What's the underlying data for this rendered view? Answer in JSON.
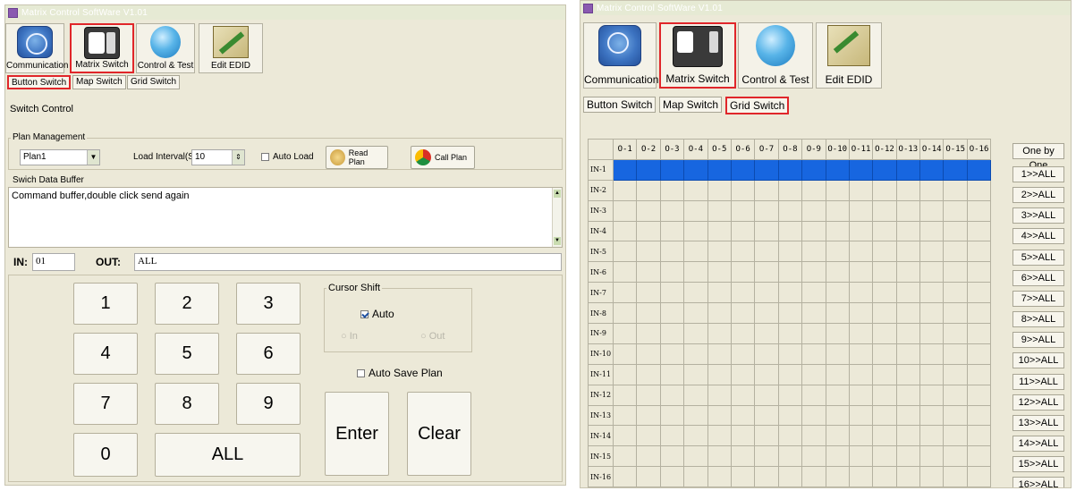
{
  "left_window": {
    "title": "Matrix Control SoftWare V1.01",
    "toolbar": [
      "Communication",
      "Matrix Switch",
      "Control & Test",
      "Edit EDID"
    ],
    "tabs": [
      "Button Switch",
      "Map Switch",
      "Grid Switch"
    ],
    "switch_control": "Switch Control",
    "plan_management": "Plan Management",
    "plan_value": "Plan1",
    "load_interval_label": "Load Interval(S)",
    "load_interval_value": "10",
    "auto_load": "Auto Load",
    "read_plan": "Read Plan",
    "call_plan": "Call Plan",
    "buffer_title": "Swich Data Buffer",
    "buffer_text": "Command buffer,double click send again",
    "in_label": "IN:",
    "in_value": "01",
    "out_label": "OUT:",
    "out_value": "ALL",
    "keys": [
      "1",
      "2",
      "3",
      "4",
      "5",
      "6",
      "7",
      "8",
      "9",
      "0",
      "ALL"
    ],
    "cursor_shift": "Cursor Shift",
    "auto": "Auto",
    "in_radio": "In",
    "out_radio": "Out",
    "auto_save_plan": "Auto Save Plan",
    "enter": "Enter",
    "clear": "Clear"
  },
  "right_window": {
    "title": "Matrix Control SoftWare V1.01",
    "toolbar": [
      "Communication",
      "Matrix Switch",
      "Control & Test",
      "Edit EDID"
    ],
    "tabs": [
      "Button Switch",
      "Map Switch",
      "Grid Switch"
    ],
    "outputs": [
      "O-1",
      "O-2",
      "O-3",
      "O-4",
      "O-5",
      "O-6",
      "O-7",
      "O-8",
      "O-9",
      "O-10",
      "O-11",
      "O-12",
      "O-13",
      "O-14",
      "O-15",
      "O-16"
    ],
    "inputs": [
      "IN-1",
      "IN-2",
      "IN-3",
      "IN-4",
      "IN-5",
      "IN-6",
      "IN-7",
      "IN-8",
      "IN-9",
      "IN-10",
      "IN-11",
      "IN-12",
      "IN-13",
      "IN-14",
      "IN-15",
      "IN-16"
    ],
    "one_by_one": "One by One",
    "row_buttons": [
      "1>>ALL",
      "2>>ALL",
      "3>>ALL",
      "4>>ALL",
      "5>>ALL",
      "6>>ALL",
      "7>>ALL",
      "8>>ALL",
      "9>>ALL",
      "10>>ALL",
      "11>>ALL",
      "12>>ALL",
      "13>>ALL",
      "14>>ALL",
      "15>>ALL",
      "16>>ALL"
    ],
    "active_row": "IN-1"
  },
  "colors": {
    "selected_border": "#e0262a",
    "grid_active": "#1766e0",
    "window_bg": "#ece9d8"
  }
}
